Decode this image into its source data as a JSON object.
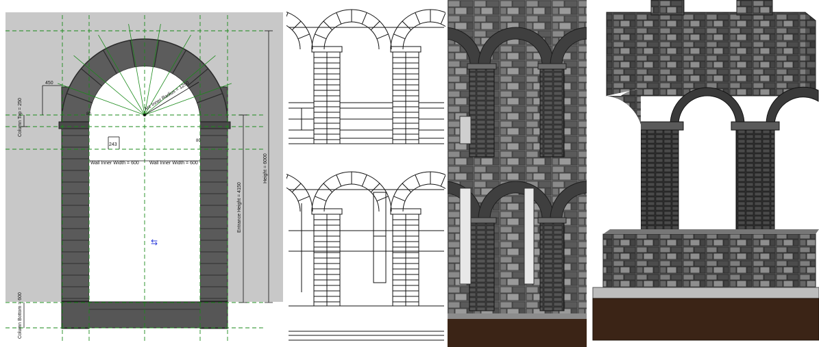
{
  "cad_drawing": {
    "dimensions": {
      "offset_top": "450",
      "column_top": "Column Top = 250",
      "arc_inner_radius": "Arc Inner Radius = 1250",
      "wall_inner_width_left": "Wall Inner Width = 600",
      "wall_inner_width_right": "Wall Inner Width = 600",
      "offset_left": "80",
      "offset_right": "80",
      "offset_mid": "243",
      "height": "Height = 6000",
      "entrance_height": "Entrance Height = 4150",
      "column_bottom": "Column Bottom = 600"
    },
    "colors": {
      "background": "#c8c8c8",
      "stone": "#5c5c5c",
      "stone_dark": "#3a3a3a",
      "reference_line": "#1a8a1a"
    }
  },
  "elevation_views": {
    "view_count": 2
  },
  "rendered_views": {
    "colors": {
      "stone": "#6a6a6a",
      "ground": "#3b2416",
      "base_slab": "#b8b8b8"
    }
  }
}
